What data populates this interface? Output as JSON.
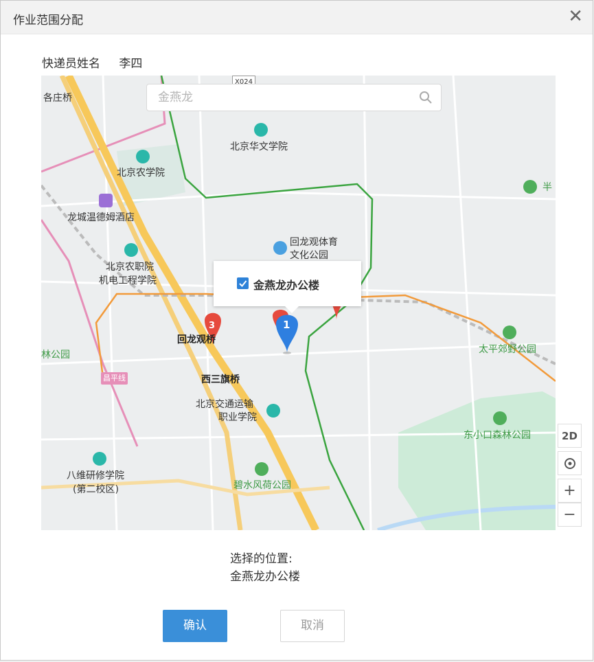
{
  "dialog": {
    "title": "作业范围分配",
    "close_icon": "close-icon"
  },
  "courier": {
    "label": "快递员姓名",
    "name": "李四"
  },
  "search": {
    "placeholder": "金燕龙"
  },
  "map_labels": [
    "各庄桥",
    "北京华文学院",
    "北京农学院",
    "龙城温德姆酒店",
    "回龙观体育",
    "文化公园",
    "北京农职院",
    "机电工程学院",
    "回龙观桥",
    "林公园",
    "西三旗桥",
    "北京交通运输",
    "职业学院",
    "八维研修学院",
    "(第二校区)",
    "碧水风荷公园",
    "太平郊野公园",
    "东小口森林公园",
    "昌平线",
    "X024",
    "半"
  ],
  "popup": {
    "label": "金燕龙办公楼",
    "checked": true
  },
  "markers": {
    "blue": "1",
    "red_cluster": "3"
  },
  "controls": {
    "mode": "2D",
    "locate_icon": "locate-icon",
    "zoom_in": "+",
    "zoom_out": "−"
  },
  "selected": {
    "label": "选择的位置:",
    "value": "金燕龙办公楼"
  },
  "buttons": {
    "confirm": "确认",
    "cancel": "取消"
  },
  "colors": {
    "primary": "#3a8fd9",
    "road_yellow": "#f7c85a",
    "metro_green": "#3aa43f",
    "metro_orange": "#f29a3a",
    "park": "#c8ebd6"
  }
}
